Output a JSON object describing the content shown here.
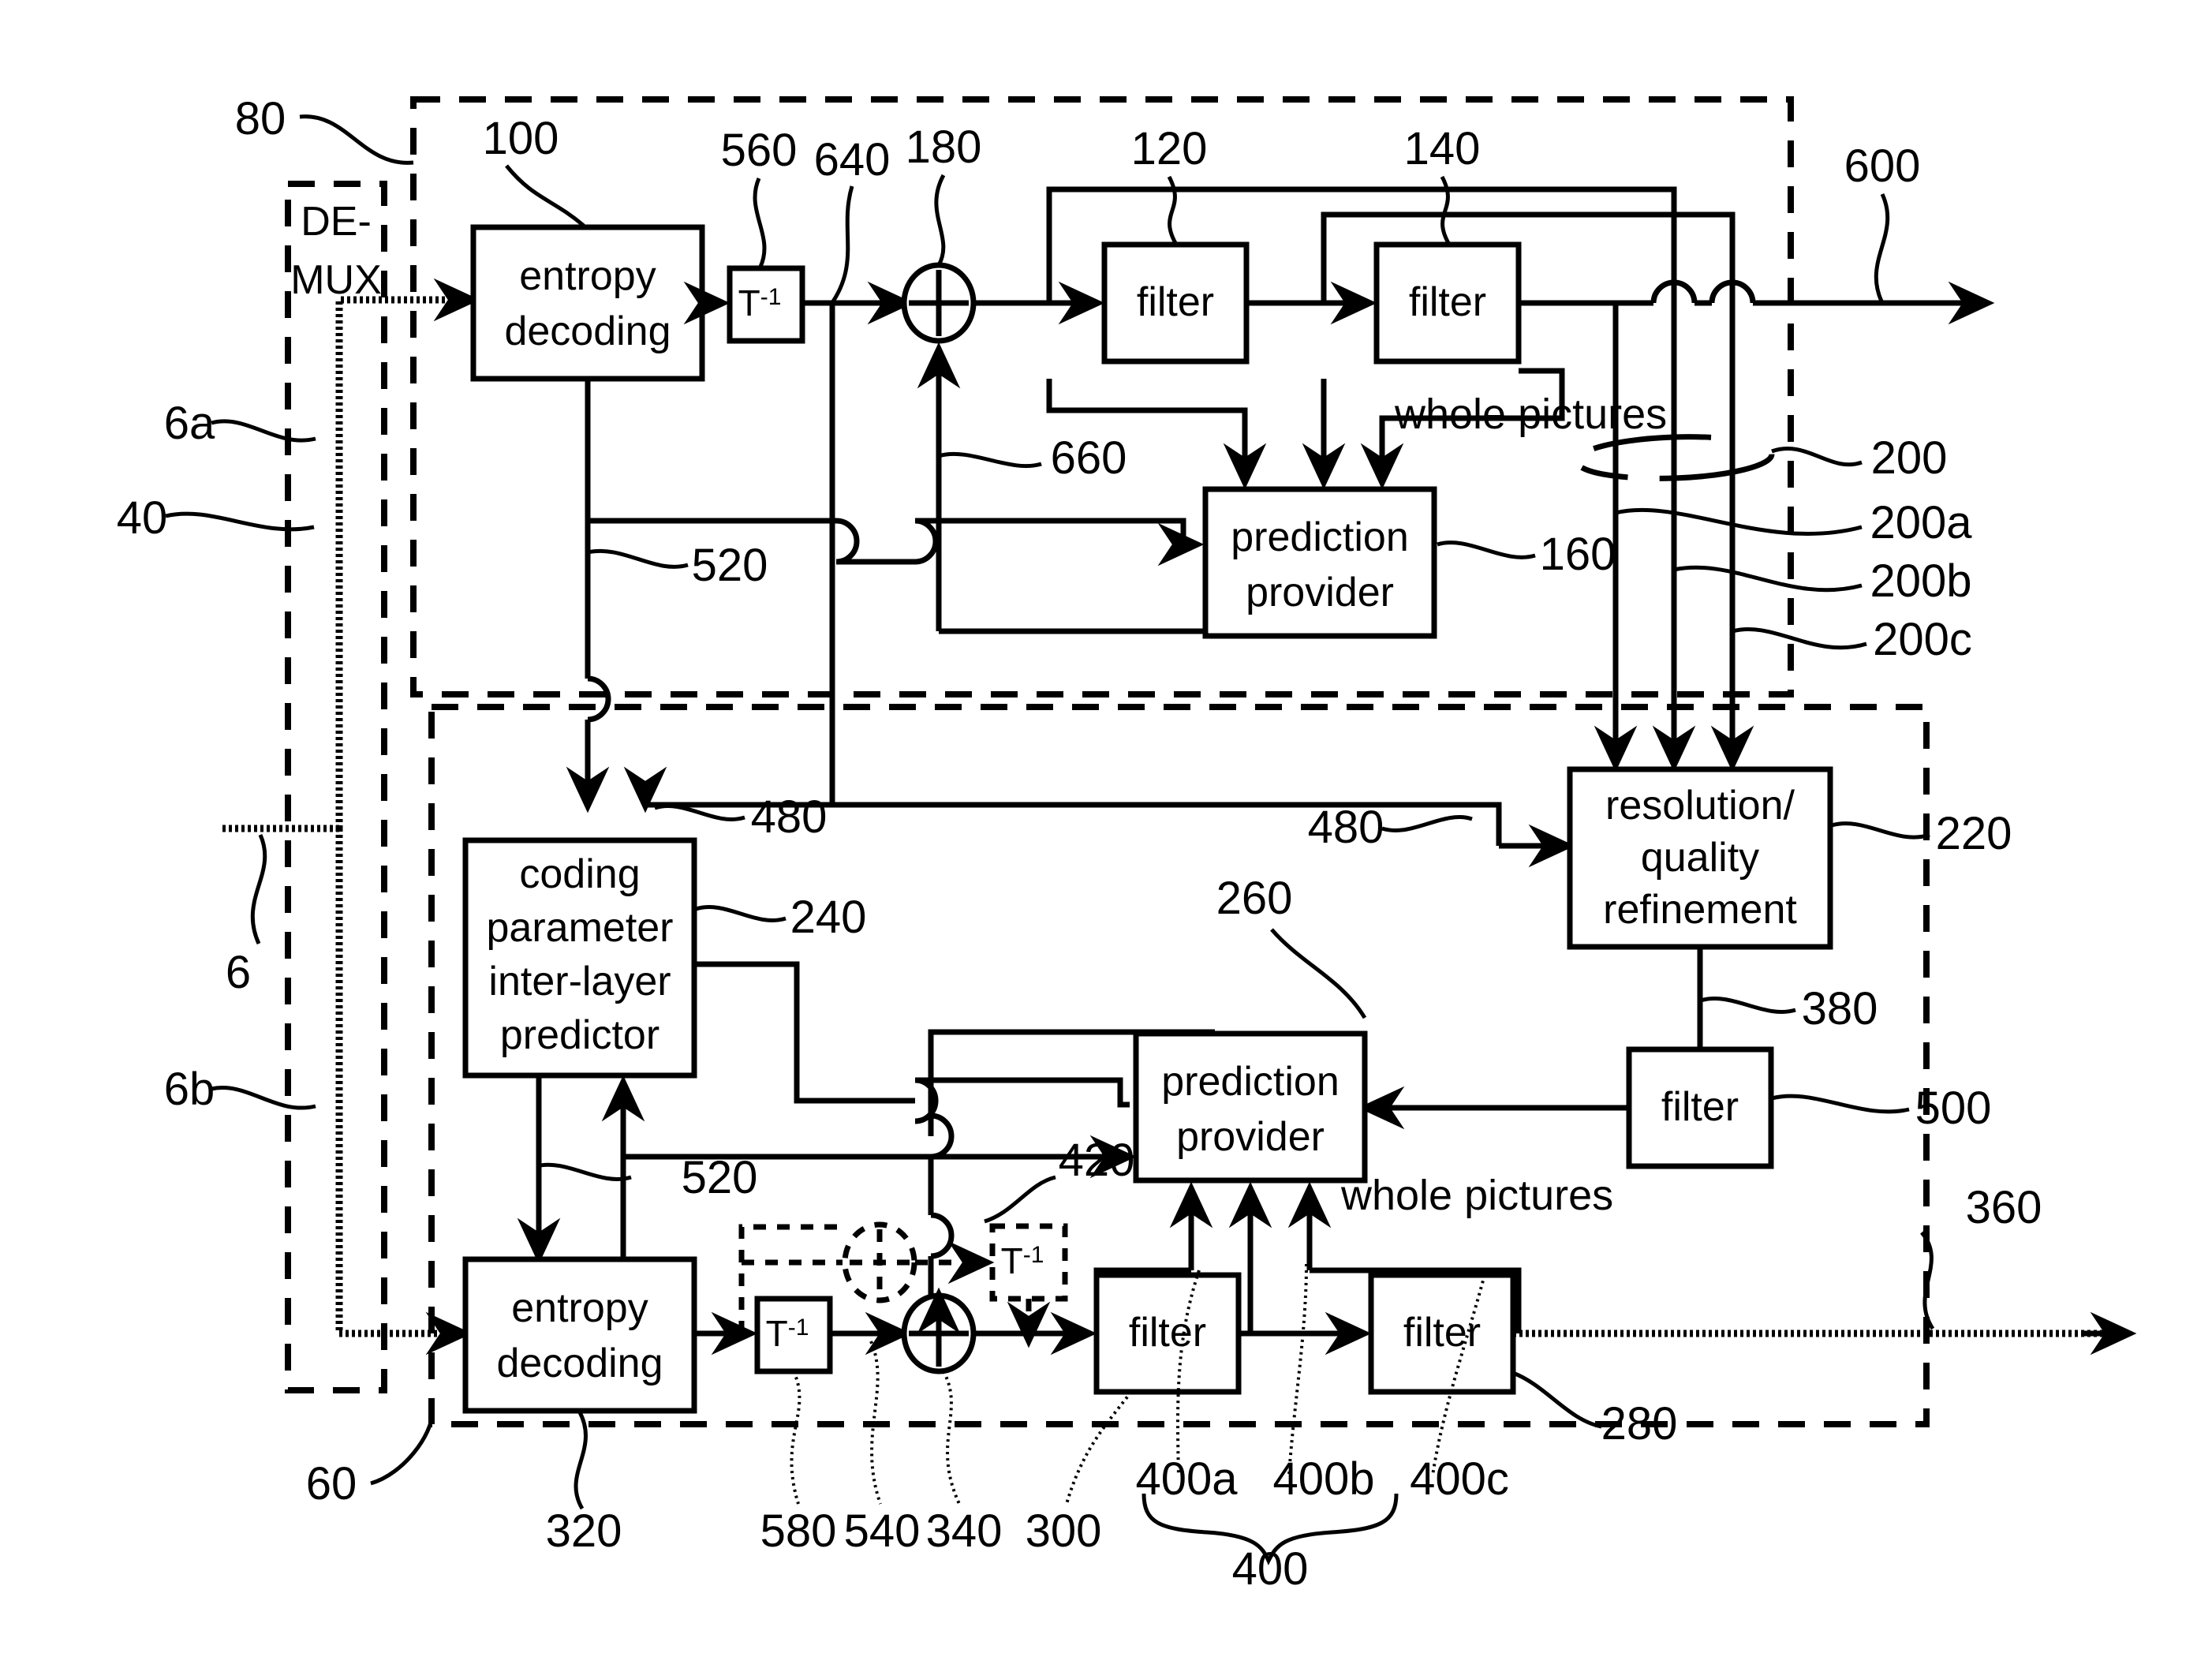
{
  "figure": {
    "type": "patent-block-diagram",
    "description": "Scalable video decoder block diagram with two layers",
    "blocks": [
      {
        "id": "demux",
        "label": "DE-\nMUX",
        "ref": "40"
      },
      {
        "id": "ent-dec-top",
        "label": "entropy\ndecoding",
        "ref": "100"
      },
      {
        "id": "tinv-top",
        "label": "T-1",
        "ref": "560"
      },
      {
        "id": "adder-top",
        "label": "+",
        "ref": "180"
      },
      {
        "id": "filter-120",
        "label": "filter",
        "ref": "120"
      },
      {
        "id": "filter-140",
        "label": "filter",
        "ref": "140"
      },
      {
        "id": "pred-top",
        "label": "prediction\nprovider",
        "ref": "160"
      },
      {
        "id": "res-qual",
        "label": "resolution/\nquality\nrefinement",
        "ref": "220"
      },
      {
        "id": "filter-500",
        "label": "filter",
        "ref": "500"
      },
      {
        "id": "cp-pred",
        "label": "coding\nparameter\ninter-layer\npredictor",
        "ref": "240"
      },
      {
        "id": "pred-bot",
        "label": "prediction\nprovider",
        "ref": "260"
      },
      {
        "id": "ent-dec-bot",
        "label": "entropy\ndecoding",
        "ref": "320"
      },
      {
        "id": "tinv-bot",
        "label": "T-1",
        "ref": "580"
      },
      {
        "id": "adder-bot",
        "label": "+",
        "ref": "340"
      },
      {
        "id": "adder-dash",
        "label": "+",
        "ref": ""
      },
      {
        "id": "tinv-dash",
        "label": "T-1",
        "ref": "420"
      },
      {
        "id": "filter-400a",
        "label": "filter",
        "ref": "300"
      },
      {
        "id": "filter-400c",
        "label": "filter",
        "ref": "280"
      }
    ],
    "block_labels": {
      "demux_line1": "DE-",
      "demux_line2": "MUX",
      "entropy_line1": "entropy",
      "entropy_line2": "decoding",
      "filter": "filter",
      "prediction_line1": "prediction",
      "prediction_line2": "provider",
      "resolution_line1": "resolution/",
      "resolution_line2": "quality",
      "resolution_line3": "refinement",
      "coding_line1": "coding",
      "coding_line2": "parameter",
      "coding_line3": "inter-layer",
      "coding_line4": "predictor",
      "t_inverse_base": "T",
      "t_inverse_exp": "-1",
      "plus": "+",
      "whole_pictures": "whole pictures"
    },
    "reference_numerals": {
      "n80": "80",
      "n100": "100",
      "n560": "560",
      "n640": "640",
      "n180": "180",
      "n120": "120",
      "n140": "140",
      "n600": "600",
      "n6a": "6a",
      "n40": "40",
      "n660": "660",
      "n200": "200",
      "n200a": "200a",
      "n200b": "200b",
      "n200c": "200c",
      "n520_top": "520",
      "n160": "160",
      "n6": "6",
      "n480_left": "480",
      "n480_right": "480",
      "n220": "220",
      "n240": "240",
      "n260": "260",
      "n380": "380",
      "n500": "500",
      "n6b": "6b",
      "n520_bot": "520",
      "n420": "420",
      "n360": "360",
      "n60": "60",
      "n320": "320",
      "n580": "580",
      "n540": "540",
      "n340": "340",
      "n300": "300",
      "n400a": "400a",
      "n400b": "400b",
      "n400c": "400c",
      "n400": "400",
      "n280": "280"
    },
    "annotations": {
      "whole_pictures_top": "whole pictures",
      "whole_pictures_bottom": "whole pictures"
    }
  }
}
